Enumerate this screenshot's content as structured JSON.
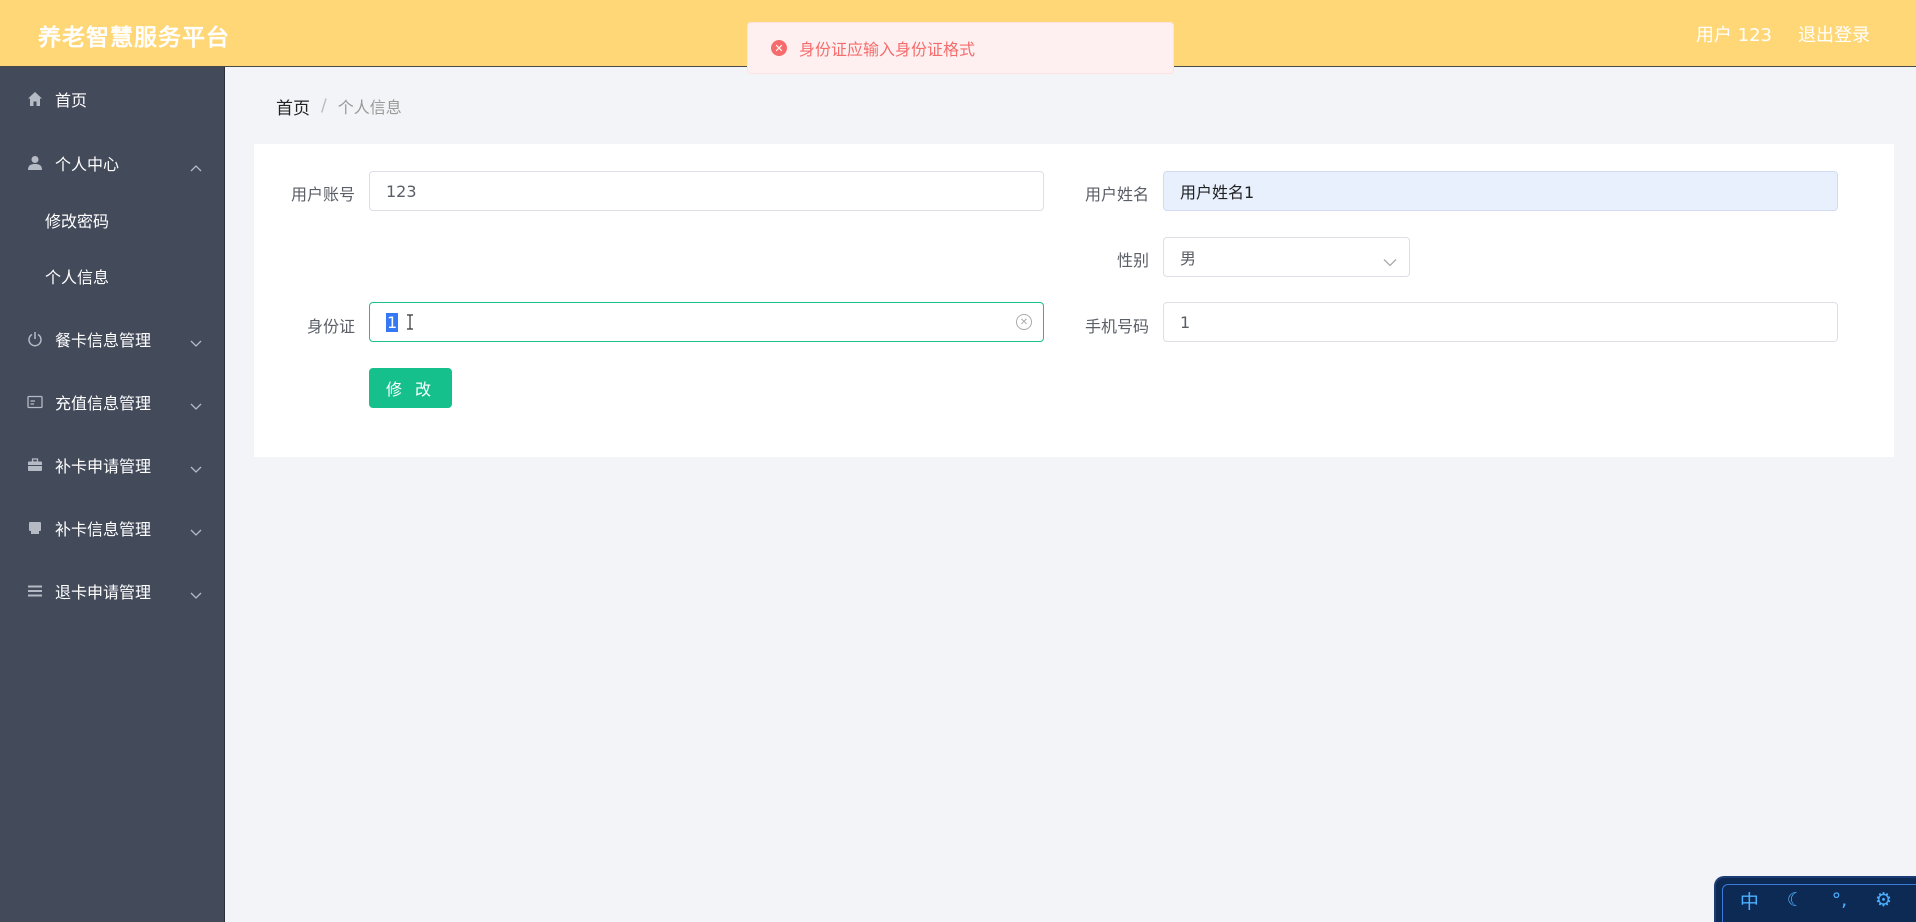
{
  "header": {
    "title": "养老智慧服务平台",
    "user": "用户 123",
    "logout": "退出登录"
  },
  "toast": {
    "message": "身份证应输入身份证格式"
  },
  "sidebar": {
    "items": [
      {
        "label": "首页",
        "icon": "home-icon"
      },
      {
        "label": "个人中心",
        "icon": "user-icon",
        "expanded": true,
        "children": [
          "修改密码",
          "个人信息"
        ]
      },
      {
        "label": "餐卡信息管理",
        "icon": "power-icon"
      },
      {
        "label": "充值信息管理",
        "icon": "card-icon"
      },
      {
        "label": "补卡申请管理",
        "icon": "briefcase-icon"
      },
      {
        "label": "补卡信息管理",
        "icon": "printer-icon"
      },
      {
        "label": "退卡申请管理",
        "icon": "list-icon"
      }
    ]
  },
  "breadcrumb": {
    "home": "首页",
    "separator": "/",
    "current": "个人信息"
  },
  "form": {
    "account_label": "用户账号",
    "account_value": "123",
    "name_label": "用户姓名",
    "name_value": "用户姓名1",
    "gender_label": "性别",
    "gender_value": "男",
    "idcard_label": "身份证",
    "idcard_value": "1",
    "phone_label": "手机号码",
    "phone_value": "1",
    "submit": "修 改"
  },
  "ime": {
    "mode": "中"
  },
  "colors": {
    "header_bg": "#ffd777",
    "sidebar_bg": "#434a5a",
    "accent": "#16c08c",
    "error": "#f56c6c"
  }
}
